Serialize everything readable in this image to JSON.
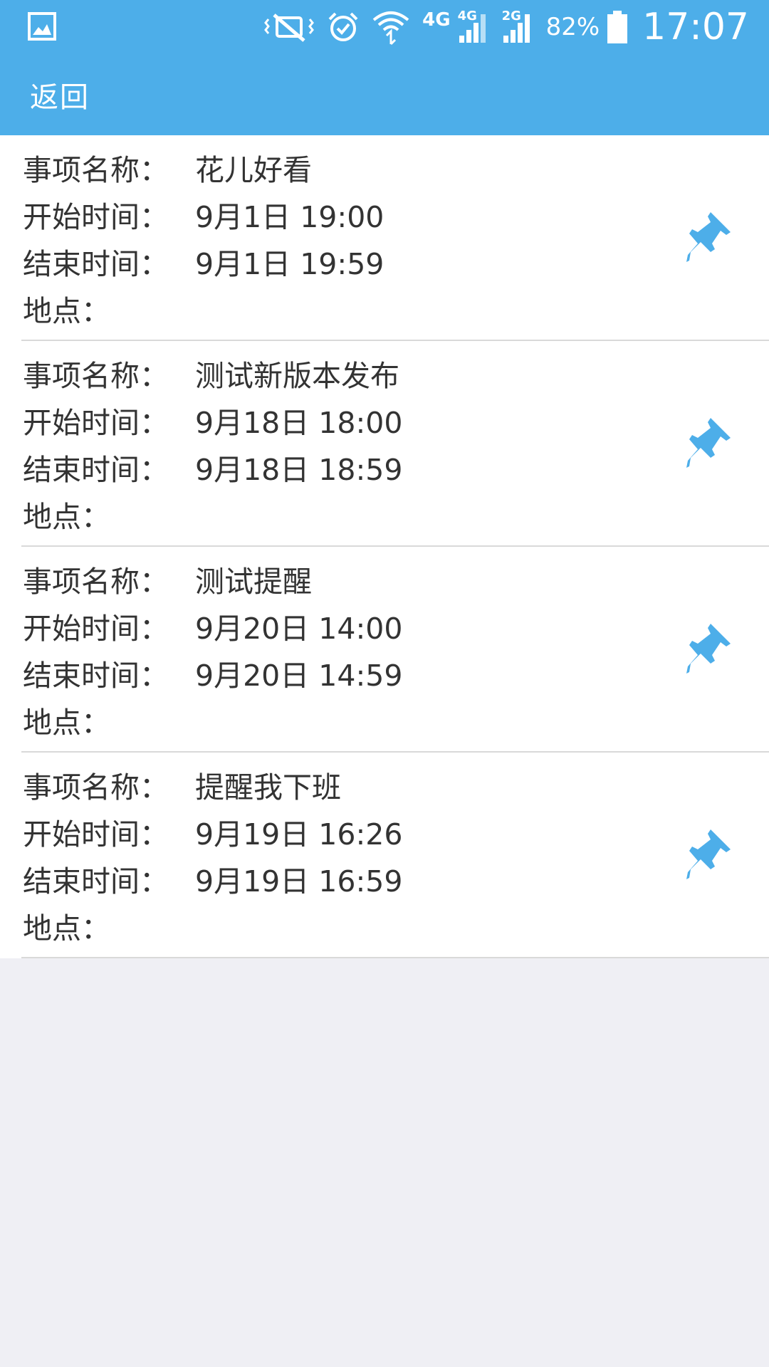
{
  "status_bar": {
    "network_label": "4G",
    "signal1_label": "4G",
    "signal2_label": "2G",
    "battery": "82%",
    "time": "17:07",
    "icons": [
      "gallery-icon",
      "vibrate-icon",
      "alarm-icon",
      "wifi-icon",
      "signal-icon",
      "battery-icon"
    ]
  },
  "app_bar": {
    "back_label": "返回"
  },
  "labels": {
    "name": "事项名称：",
    "start": "开始时间：",
    "end": "结束时间：",
    "location": "地点："
  },
  "events": [
    {
      "name": "花儿好看",
      "start": "9月1日 19:00",
      "end": "9月1日 19:59",
      "location": ""
    },
    {
      "name": "测试新版本发布",
      "start": "9月18日 18:00",
      "end": "9月18日 18:59",
      "location": ""
    },
    {
      "name": "测试提醒",
      "start": "9月20日 14:00",
      "end": "9月20日 14:59",
      "location": ""
    },
    {
      "name": "提醒我下班",
      "start": "9月19日 16:26",
      "end": "9月19日 16:59",
      "location": ""
    }
  ],
  "colors": {
    "accent": "#4daee9",
    "background": "#efeff4",
    "text": "#333333",
    "pin": "#4daee9"
  }
}
